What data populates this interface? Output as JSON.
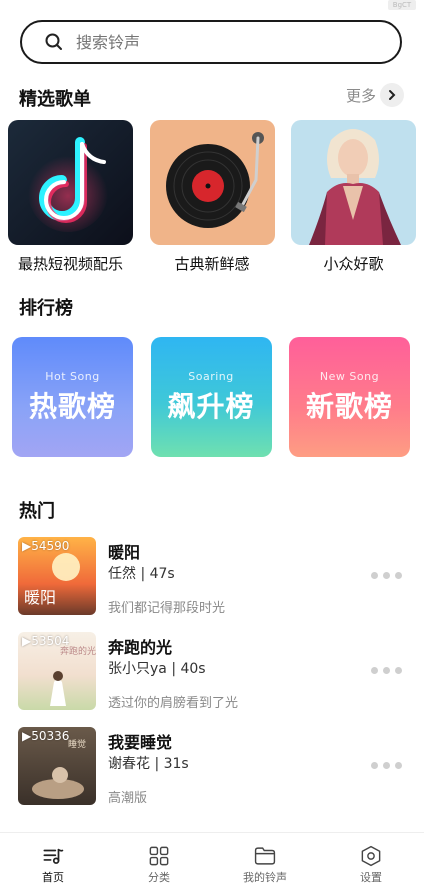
{
  "status_tag": "BgCT",
  "search": {
    "placeholder": "搜索铃声"
  },
  "featured": {
    "title": "精选歌单",
    "more_label": "更多",
    "items": [
      {
        "name": "最热短视频配乐"
      },
      {
        "name": "古典新鲜感"
      },
      {
        "name": "小众好歌"
      }
    ]
  },
  "charts": {
    "title": "排行榜",
    "items": [
      {
        "en": "Hot Song",
        "cn": "热歌榜"
      },
      {
        "en": "Soaring",
        "cn": "飙升榜"
      },
      {
        "en": "New Song",
        "cn": "新歌榜"
      }
    ]
  },
  "hot": {
    "title": "热门",
    "songs": [
      {
        "plays": "54590",
        "title": "暖阳",
        "meta": "任然 | 47s",
        "desc": "我们都记得那段时光",
        "thumb_text": "暖阳"
      },
      {
        "plays": "53504",
        "title": "奔跑的光",
        "meta": "张小只ya | 40s",
        "desc": "透过你的肩膀看到了光",
        "thumb_text": "奔跑的光"
      },
      {
        "plays": "50336",
        "title": "我要睡觉",
        "meta": "谢春花 | 31s",
        "desc": "高潮版",
        "thumb_text": "睡觉"
      }
    ]
  },
  "tabbar": {
    "items": [
      {
        "label": "首页",
        "icon": "music-list-icon"
      },
      {
        "label": "分类",
        "icon": "grid-icon"
      },
      {
        "label": "我的铃声",
        "icon": "folder-icon"
      },
      {
        "label": "设置",
        "icon": "hexagon-settings-icon"
      }
    ]
  }
}
